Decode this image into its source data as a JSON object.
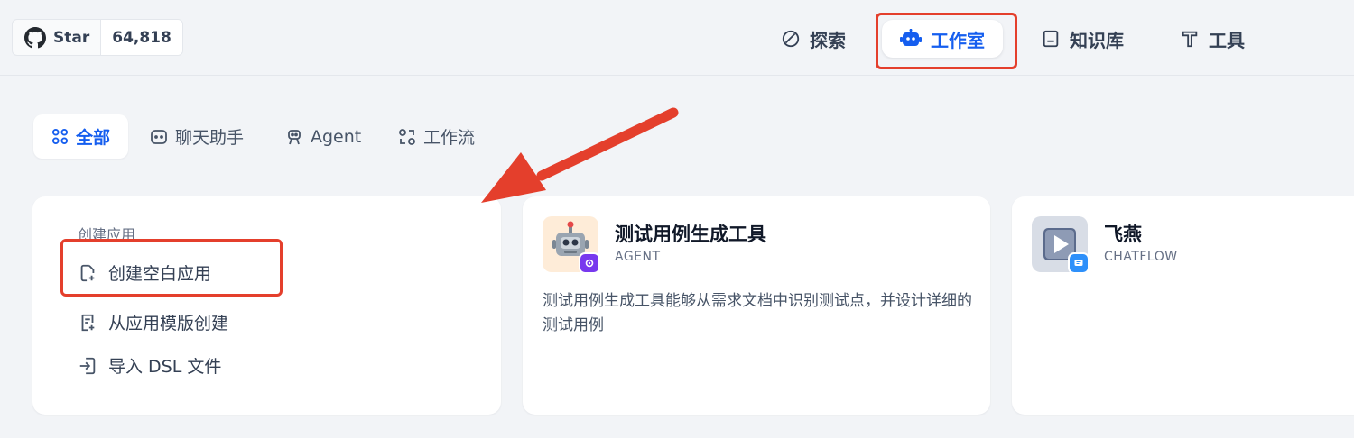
{
  "github": {
    "label": "Star",
    "count": "64,818"
  },
  "nav": {
    "explore": "探索",
    "studio": "工作室",
    "knowledge": "知识库",
    "tools": "工具"
  },
  "tabs": {
    "all": "全部",
    "chat": "聊天助手",
    "agent": "Agent",
    "workflow": "工作流"
  },
  "create": {
    "title": "创建应用",
    "blank": "创建空白应用",
    "template": "从应用模版创建",
    "import": "导入 DSL 文件"
  },
  "apps": [
    {
      "name": "测试用例生成工具",
      "type": "AGENT",
      "description": "测试用例生成工具能够从需求文档中识别测试点，并设计详细的测试用例"
    },
    {
      "name": "飞燕",
      "type": "CHATFLOW",
      "description": ""
    }
  ],
  "colors": {
    "accent": "#155eef",
    "annotation": "#e43f2c"
  }
}
